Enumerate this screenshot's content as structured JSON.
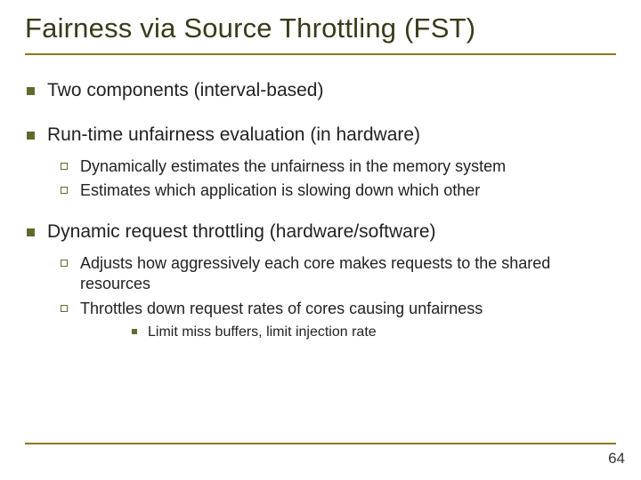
{
  "title": "Fairness via Source Throttling (FST)",
  "items": [
    {
      "text": "Two components (interval-based)"
    },
    {
      "text": "Run-time unfairness evaluation (in hardware)",
      "sub": [
        {
          "text": "Dynamically estimates the unfairness in the memory system"
        },
        {
          "text": "Estimates which application is slowing down which other"
        }
      ]
    },
    {
      "text": "Dynamic request throttling (hardware/software)",
      "sub": [
        {
          "text": "Adjusts how aggressively each core makes requests to the shared resources"
        },
        {
          "text": "Throttles down request rates of cores causing unfairness",
          "sub": [
            {
              "text": "Limit miss buffers, limit injection rate"
            }
          ]
        }
      ]
    }
  ],
  "page_number": "64"
}
